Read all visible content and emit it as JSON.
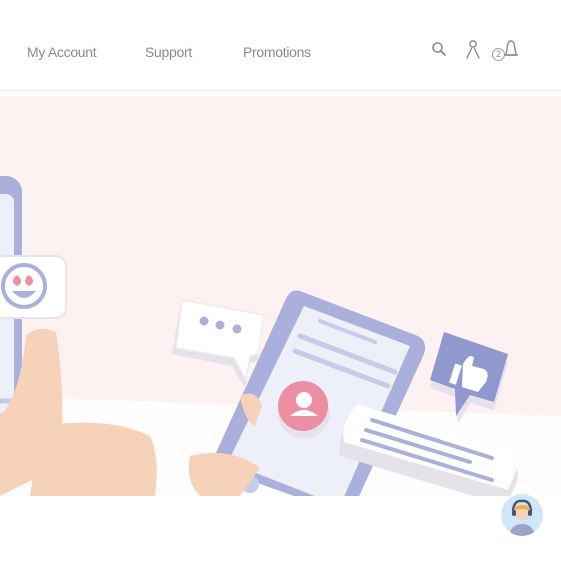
{
  "nav": {
    "links": [
      "My Account",
      "Support",
      "Promotions"
    ]
  },
  "icons": {
    "search": "search-icon",
    "account": "user-icon",
    "notifications": "bell-icon",
    "support_chat": "support-agent-icon"
  },
  "notifications": {
    "count": "2"
  },
  "colors": {
    "hero_background": "#fdf1f1",
    "illustration_blue": "#a8b0db",
    "skin": "#f6d3b8",
    "accent_pink": "#ec8fa3",
    "nav_text": "#8a8a8a"
  }
}
